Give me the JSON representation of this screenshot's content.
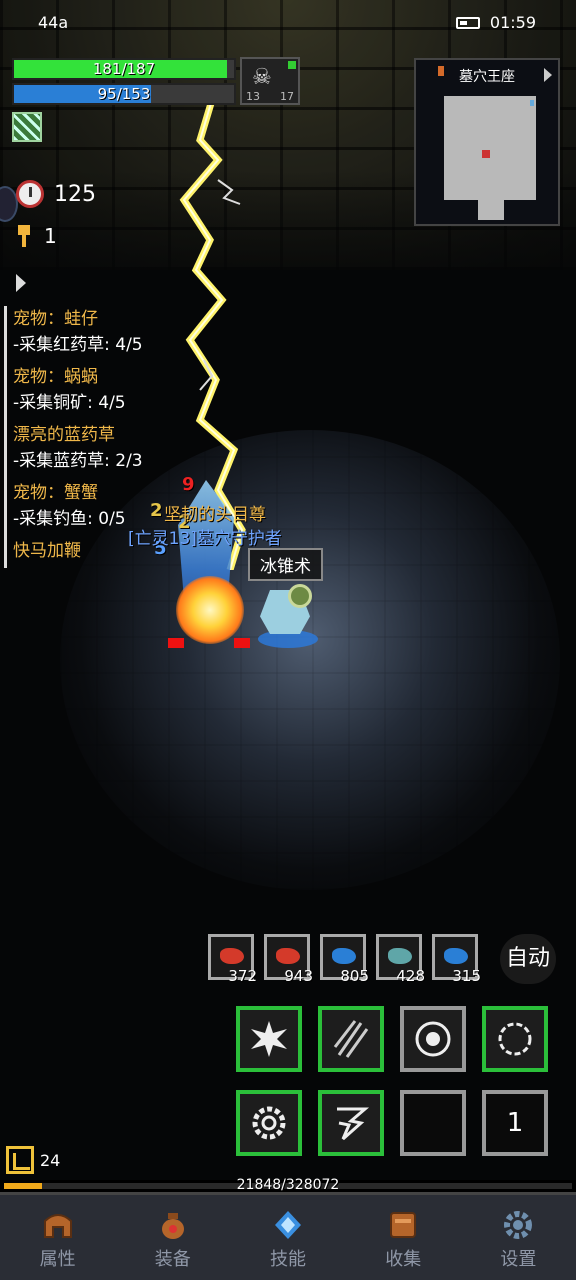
{
  "status_bar": {
    "left_text": "44a",
    "time": "01:59"
  },
  "player": {
    "hp_text": "181/187",
    "hp_fraction": 0.968,
    "mp_text": "95/153",
    "mp_fraction": 0.621,
    "portrait": {
      "icon": "skull-icon",
      "left_value": "13",
      "right_value": "17"
    }
  },
  "timer": {
    "icon": "clock-icon",
    "value": "125"
  },
  "keys": {
    "icon": "key-icon",
    "value": "1"
  },
  "quests": [
    {
      "title": "宠物：蛙仔",
      "progress": "-采集红药草: 4/5"
    },
    {
      "title": "宠物：蜗蜗",
      "progress": "-采集铜矿: 4/5"
    },
    {
      "title": "漂亮的蓝药草",
      "progress": "-采集蓝药草: 2/3"
    },
    {
      "title": "宠物：蟹蟹",
      "progress": "-采集钓鱼: 0/5"
    },
    {
      "title": "快马加鞭",
      "progress": ""
    }
  ],
  "minimap": {
    "title": "墓穴王座"
  },
  "battle": {
    "damage_numbers": [
      "9",
      "2",
      "2",
      "5"
    ],
    "enemy_title": "坚韧的头目尊",
    "enemy_name": "[亡灵13]墓穴守护者",
    "skill_cast": "冰锥术"
  },
  "consumables": [
    {
      "icon": "red-meat-icon",
      "count": "372",
      "color": "#d43a2a"
    },
    {
      "icon": "red-potion-icon",
      "count": "943",
      "color": "#d43a2a"
    },
    {
      "icon": "blue-potion-icon",
      "count": "805",
      "color": "#2a7fd6"
    },
    {
      "icon": "fish-icon",
      "count": "428",
      "color": "#5fa6a8"
    },
    {
      "icon": "blue-herb-icon",
      "count": "315",
      "color": "#2a7fd6"
    }
  ],
  "auto_label": "自动",
  "skills": [
    {
      "icon": "shatter-skill-icon",
      "label": ""
    },
    {
      "icon": "claw-skill-icon",
      "label": ""
    },
    {
      "icon": "nova-skill-icon",
      "label": ""
    },
    {
      "icon": "ring-skill-icon",
      "label": ""
    },
    {
      "icon": "gear-skill-icon",
      "label": ""
    },
    {
      "icon": "lightning-skill-icon",
      "label": ""
    },
    {
      "icon": "empty-slot",
      "label": ""
    },
    {
      "icon": "slot-number",
      "label": "1"
    }
  ],
  "level": {
    "value": "24"
  },
  "xp": {
    "text": "21848/328072",
    "fraction": 0.0666
  },
  "nav": [
    {
      "label": "属性",
      "icon": "helmet-icon"
    },
    {
      "label": "装备",
      "icon": "bag-icon"
    },
    {
      "label": "技能",
      "icon": "crystal-icon"
    },
    {
      "label": "收集",
      "icon": "book-icon"
    },
    {
      "label": "设置",
      "icon": "gear-icon"
    }
  ]
}
